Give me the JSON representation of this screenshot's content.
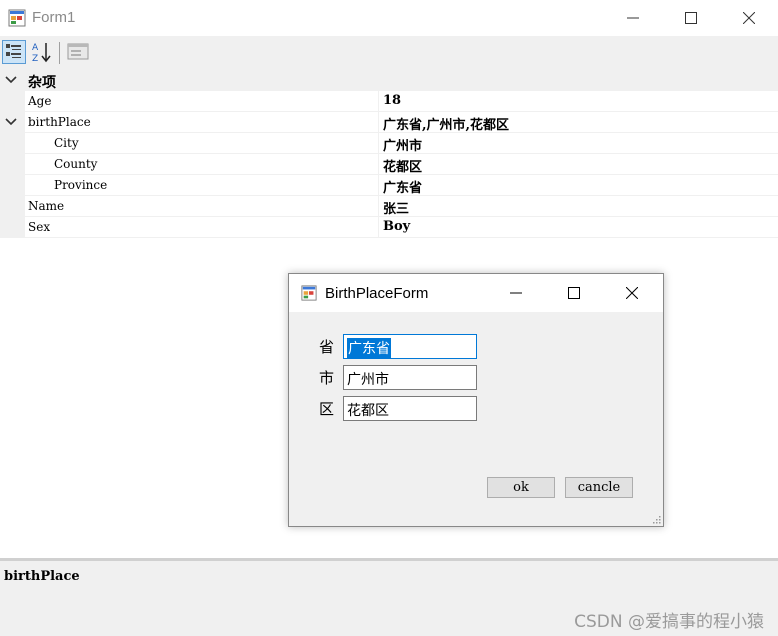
{
  "window": {
    "title": "Form1"
  },
  "toolbar": {
    "categorized_icon": "categorized-icon",
    "alphabetical_icon": "alphabetical-icon",
    "property_pages_icon": "property-pages-icon"
  },
  "grid": {
    "category": "杂项",
    "rows": [
      {
        "label": "Age",
        "value": "18"
      },
      {
        "label": "birthPlace",
        "value": "广东省,广州市,花都区"
      },
      {
        "label": "City",
        "value": "广州市"
      },
      {
        "label": "County",
        "value": "花都区"
      },
      {
        "label": "Province",
        "value": "广东省"
      },
      {
        "label": "Name",
        "value": "张三"
      },
      {
        "label": "Sex",
        "value": "Boy"
      }
    ]
  },
  "description": {
    "title": "birthPlace"
  },
  "dialog": {
    "title": "BirthPlaceForm",
    "fields": [
      {
        "label": "省",
        "value": "广东省"
      },
      {
        "label": "市",
        "value": "广州市"
      },
      {
        "label": "区",
        "value": "花都区"
      }
    ],
    "ok_label": "ok",
    "cancel_label": "cancle"
  },
  "watermark": "CSDN @爱搞事的程小猿"
}
